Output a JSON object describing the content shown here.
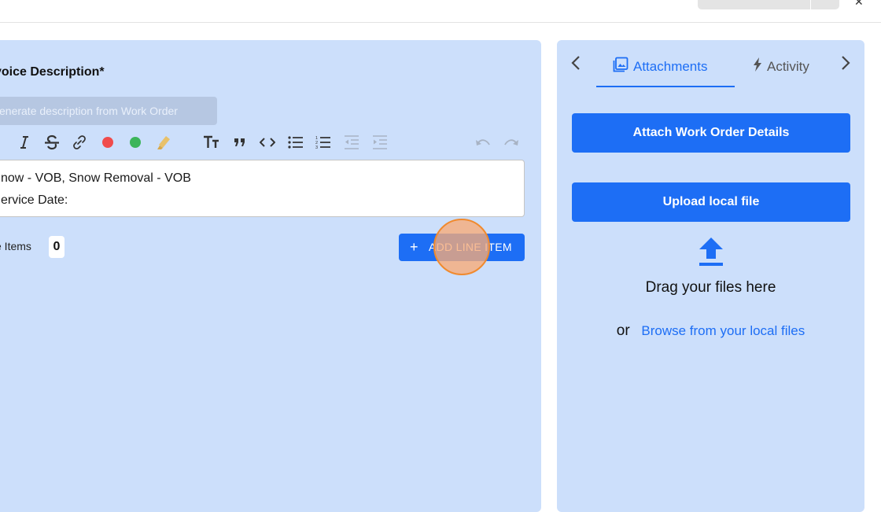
{
  "invoice": {
    "description_label": "voice Description*",
    "generate_button": "enerate description from Work Order",
    "editor_lines": [
      "now - VOB, Snow Removal - VOB",
      "ervice Date:"
    ],
    "line_items_label": "e Items",
    "line_items_count": "0",
    "add_line_item_button": "ADD LINE ITEM",
    "add_icon": "+"
  },
  "toolbar": {
    "icons": [
      "italic-icon",
      "strikethrough-icon",
      "link-icon",
      "red-color-icon",
      "green-color-icon",
      "highlighter-icon",
      "text-size-icon",
      "quote-icon",
      "code-icon",
      "bullet-list-icon",
      "numbered-list-icon",
      "outdent-icon",
      "indent-icon",
      "undo-icon",
      "redo-icon"
    ],
    "colors": {
      "red": "#f04b4b",
      "green": "#3cb55a",
      "highlighter": "#e8c16a"
    }
  },
  "side_panel": {
    "tabs": [
      {
        "label": "Attachments",
        "active": true,
        "icon": "image-icon"
      },
      {
        "label": "Activity",
        "active": false,
        "icon": "bolt-icon"
      }
    ],
    "attach_button": "Attach Work Order Details",
    "upload_button": "Upload local file",
    "drag_text": "Drag your files here",
    "or_text": "or",
    "browse_link": "Browse from your local files"
  },
  "colors": {
    "accent": "#1d6ef5",
    "panel_bg": "#ccdffb"
  }
}
